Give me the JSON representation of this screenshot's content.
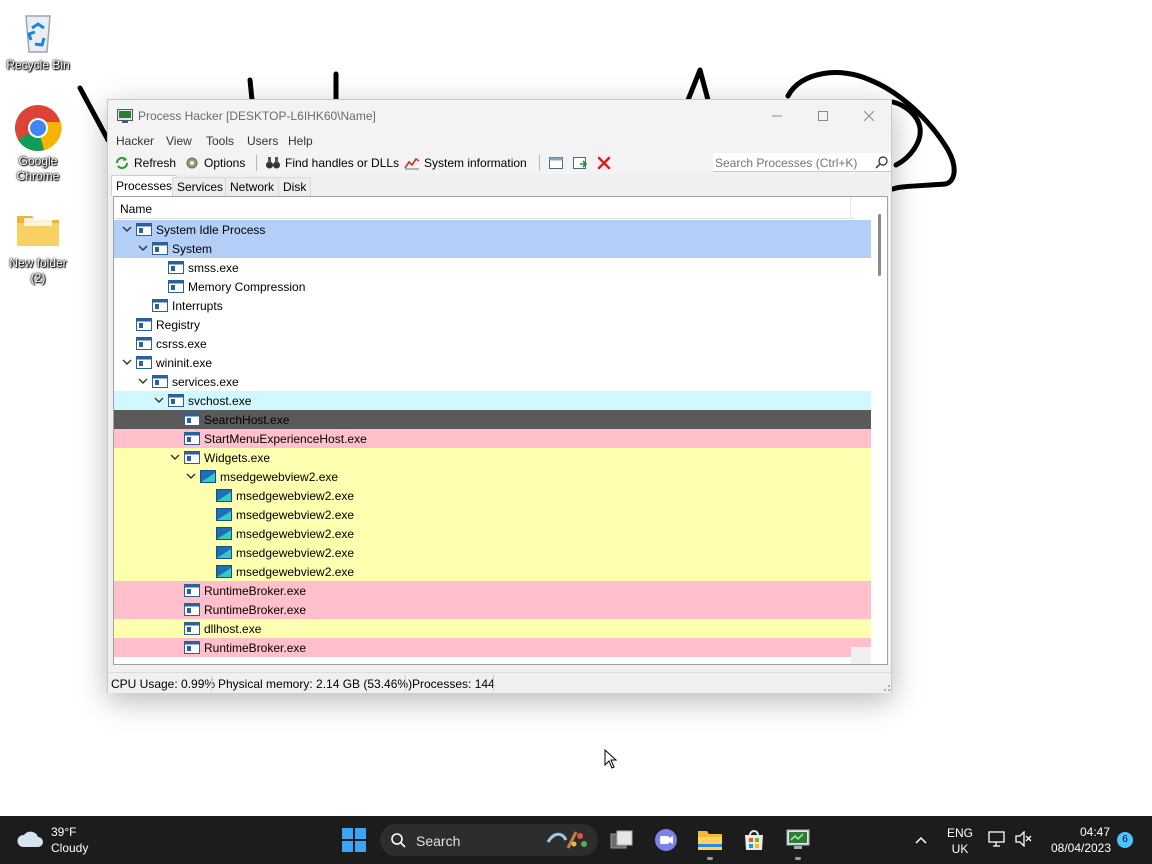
{
  "desktop": {
    "icons": [
      {
        "label": "Recycle Bin"
      },
      {
        "label": "Google Chrome"
      },
      {
        "label": "New folder (2)"
      }
    ]
  },
  "window": {
    "title": "Process Hacker [DESKTOP-L6IHK60\\Name]",
    "menu": [
      "Hacker",
      "View",
      "Tools",
      "Users",
      "Help"
    ],
    "toolbar": {
      "refresh": "Refresh",
      "options": "Options",
      "find_handles": "Find handles or DLLs",
      "system_info": "System information",
      "search_placeholder": "Search Processes (Ctrl+K)"
    },
    "tabs": [
      "Processes",
      "Services",
      "Network",
      "Disk"
    ],
    "column_header": "Name",
    "processes": [
      {
        "name": "System Idle Process",
        "level": 0,
        "expanded": true,
        "bg": "#b3cef7",
        "icon": "process-icon"
      },
      {
        "name": "System",
        "level": 1,
        "expanded": true,
        "bg": "#b3cef7",
        "icon": "process-icon"
      },
      {
        "name": "smss.exe",
        "level": 2,
        "bg": "#ffffff",
        "icon": "process-icon"
      },
      {
        "name": "Memory Compression",
        "level": 2,
        "bg": "#ffffff",
        "icon": "process-icon"
      },
      {
        "name": "Interrupts",
        "level": 1,
        "bg": "#ffffff",
        "icon": "process-icon"
      },
      {
        "name": "Registry",
        "level": 0,
        "bg": "#ffffff",
        "icon": "process-icon"
      },
      {
        "name": "csrss.exe",
        "level": 0,
        "bg": "#ffffff",
        "icon": "process-icon"
      },
      {
        "name": "wininit.exe",
        "level": 0,
        "expanded": true,
        "bg": "#ffffff",
        "icon": "process-icon"
      },
      {
        "name": "services.exe",
        "level": 1,
        "expanded": true,
        "bg": "#ffffff",
        "icon": "process-icon"
      },
      {
        "name": "svchost.exe",
        "level": 2,
        "expanded": true,
        "bg": "#d0f8ff",
        "icon": "process-icon"
      },
      {
        "name": "SearchHost.exe",
        "level": 3,
        "bg": "#5a5a5a",
        "icon": "process-icon"
      },
      {
        "name": "StartMenuExperienceHost.exe",
        "level": 3,
        "bg": "#ffc0cb",
        "icon": "process-icon"
      },
      {
        "name": "Widgets.exe",
        "level": 3,
        "expanded": true,
        "bg": "#ffffb0",
        "icon": "process-icon"
      },
      {
        "name": "msedgewebview2.exe",
        "level": 4,
        "expanded": true,
        "bg": "#ffffb0",
        "icon": "edge-webview-icon"
      },
      {
        "name": "msedgewebview2.exe",
        "level": 5,
        "bg": "#ffffb0",
        "icon": "edge-webview-icon"
      },
      {
        "name": "msedgewebview2.exe",
        "level": 5,
        "bg": "#ffffb0",
        "icon": "edge-webview-icon"
      },
      {
        "name": "msedgewebview2.exe",
        "level": 5,
        "bg": "#ffffb0",
        "icon": "edge-webview-icon"
      },
      {
        "name": "msedgewebview2.exe",
        "level": 5,
        "bg": "#ffffb0",
        "icon": "edge-webview-icon"
      },
      {
        "name": "msedgewebview2.exe",
        "level": 5,
        "bg": "#ffffb0",
        "icon": "edge-webview-icon"
      },
      {
        "name": "RuntimeBroker.exe",
        "level": 3,
        "bg": "#ffc0cb",
        "icon": "process-icon"
      },
      {
        "name": "RuntimeBroker.exe",
        "level": 3,
        "bg": "#ffc0cb",
        "icon": "process-icon"
      },
      {
        "name": "dllhost.exe",
        "level": 3,
        "bg": "#ffffb0",
        "icon": "process-icon"
      },
      {
        "name": "RuntimeBroker.exe",
        "level": 3,
        "bg": "#ffc0cb",
        "icon": "process-icon"
      }
    ],
    "status": {
      "cpu": "CPU Usage: 0.99%",
      "memory": "Physical memory: 2.14 GB (53.46%)",
      "processes": "Processes: 144"
    }
  },
  "taskbar": {
    "weather": {
      "temp": "39°F",
      "desc": "Cloudy"
    },
    "search_label": "Search",
    "lang": {
      "line1": "ENG",
      "line2": "UK"
    },
    "clock": {
      "time": "04:47",
      "date": "08/04/2023"
    },
    "notification_count": "6"
  }
}
